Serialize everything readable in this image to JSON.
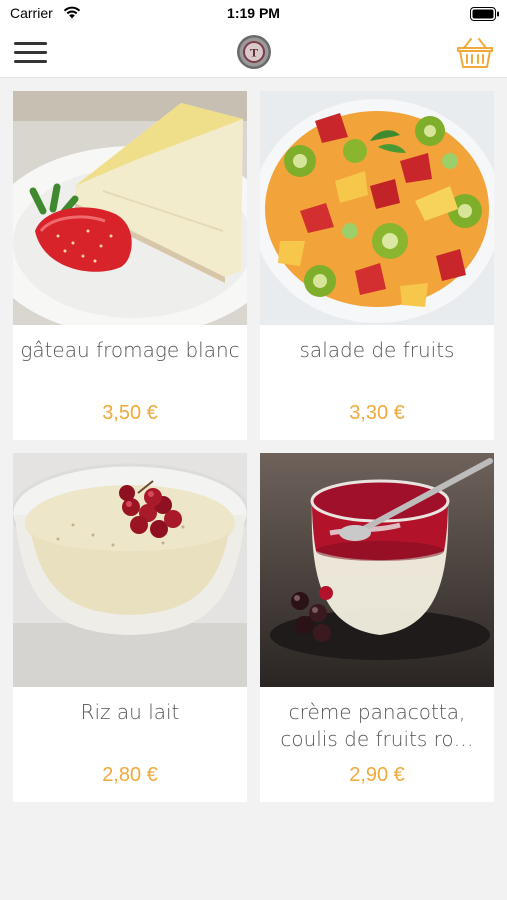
{
  "status_bar": {
    "carrier": "Carrier",
    "time": "1:19 PM"
  },
  "nav": {
    "logo_letter": "T",
    "accent_color": "#f0a93b"
  },
  "products": [
    {
      "name": "gâteau fromage blanc",
      "price": "3,50 €"
    },
    {
      "name": "salade de fruits",
      "price": "3,30 €"
    },
    {
      "name": "Riz au lait",
      "price": "2,80 €"
    },
    {
      "name": "crème panacotta, coulis de fruits ro…",
      "price": "2,90 €"
    }
  ]
}
